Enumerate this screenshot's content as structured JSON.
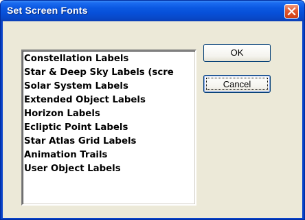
{
  "window": {
    "title": "Set Screen Fonts"
  },
  "titlebar": {
    "close_icon": "close-icon"
  },
  "list": {
    "items": [
      "Constellation Labels",
      "Star & Deep Sky Labels (scre",
      "Solar System Labels",
      "Extended Object Labels",
      "Horizon Labels",
      "Ecliptic Point Labels",
      "Star Atlas Grid Labels",
      "Animation Trails",
      "User Object Labels"
    ]
  },
  "buttons": {
    "ok_label": "OK",
    "cancel_label": "Cancel"
  },
  "colors": {
    "titlebar": "#0b58e2",
    "dialog_face": "#ece9d8",
    "close_button": "#e2582f"
  }
}
